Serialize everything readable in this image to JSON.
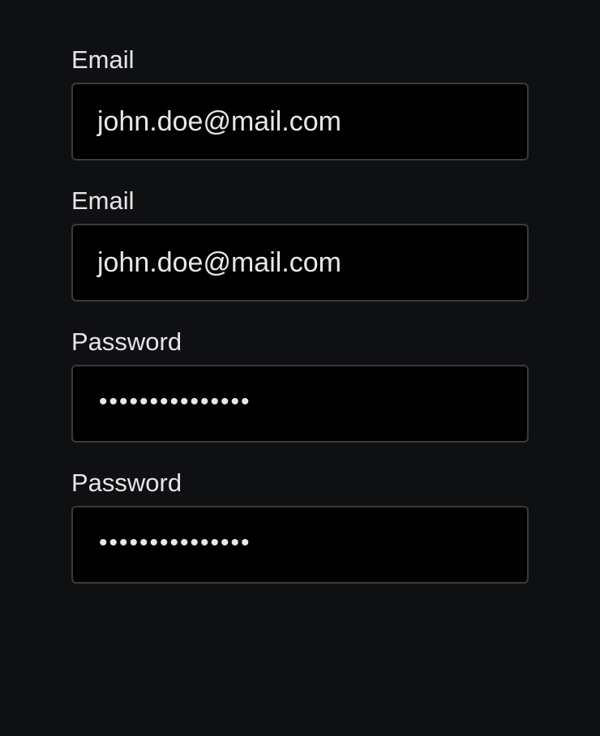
{
  "fields": [
    {
      "label": "Email",
      "value": "john.doe@mail.com",
      "type": "email"
    },
    {
      "label": "Email",
      "value": "john.doe@mail.com",
      "type": "email"
    },
    {
      "label": "Password",
      "value": "•••••••••••••••",
      "type": "password"
    },
    {
      "label": "Password",
      "value": "•••••••••••••••",
      "type": "password"
    }
  ]
}
